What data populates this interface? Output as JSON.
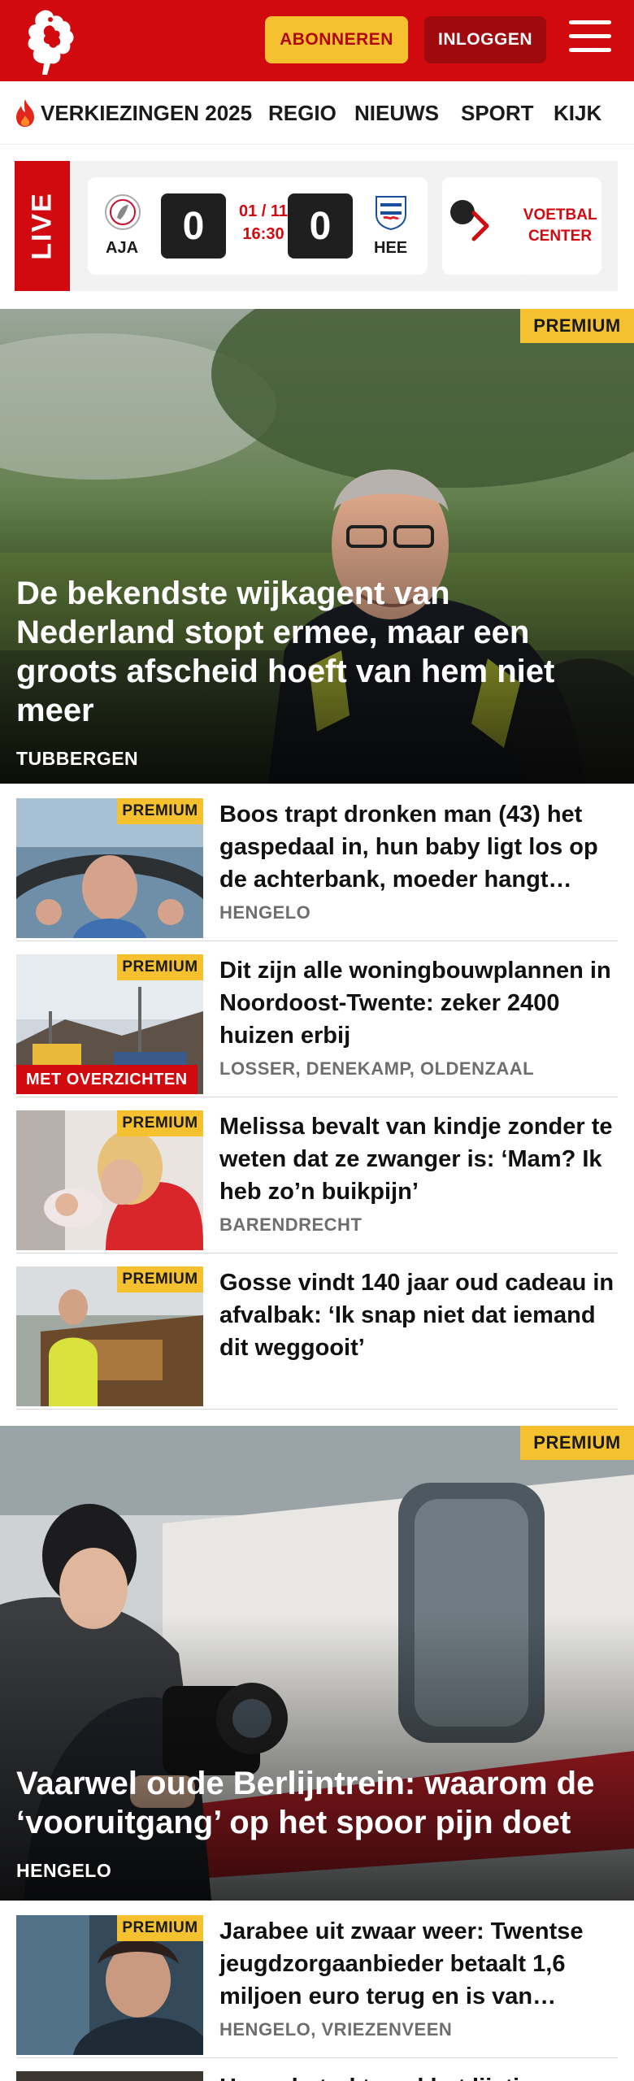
{
  "header": {
    "subscribe_label": "ABONNEREN",
    "login_label": "INLOGGEN",
    "brand_color": "#d10a10",
    "accent_color": "#f5c12e"
  },
  "nav": {
    "items": [
      {
        "label": "VERKIEZINGEN 2025",
        "icon": "flame-icon"
      },
      {
        "label": "REGIO"
      },
      {
        "label": "NIEUWS"
      },
      {
        "label": "SPORT"
      },
      {
        "label": "KIJK"
      }
    ]
  },
  "live": {
    "label": "LIVE",
    "match": {
      "home_code": "AJA",
      "home_score": "0",
      "away_code": "HEE",
      "away_score": "0",
      "date": "01 / 11",
      "time": "16:30"
    },
    "football_center_label": "VOETBAL CENTER"
  },
  "premium_label": "PREMIUM",
  "hero1": {
    "title": "De bekendste wijkagent van Nederland stopt ermee, maar een groots afscheid hoeft van hem niet meer",
    "location": "TUBBERGEN"
  },
  "articles": [
    {
      "title": "Boos trapt dronken man (43) het gaspedaal in, hun baby ligt los op de achterbank, moeder hangt…",
      "location": "HENGELO",
      "premium": true
    },
    {
      "title": "Dit zijn alle woningbouwplannen in Noordoost-Twente: zeker 2400 huizen erbij",
      "location": "LOSSER, DENEKAMP, OLDENZAAL",
      "premium": true,
      "badge": "MET OVERZICHTEN"
    },
    {
      "title": "Melissa bevalt van kindje zonder te weten dat ze zwanger is: ‘Mam? Ik heb zo’n buikpijn’",
      "location": "BARENDRECHT",
      "premium": true
    },
    {
      "title": "Gosse vindt 140 jaar oud cadeau in afvalbak: ‘Ik snap niet dat iemand dit weggooit’",
      "location": "",
      "premium": true
    }
  ],
  "hero2": {
    "title": "Vaarwel oude Berlijntrein: waarom de ‘vooruitgang’ op het spoor pijn doet",
    "location": "HENGELO"
  },
  "articles2": [
    {
      "title": "Jarabee uit zwaar weer: Twentse jeugdzorgaanbieder betaalt 1,6 miljoen euro terug en is van…",
      "location": "HENGELO, VRIEZENVEEN",
      "premium": true
    },
    {
      "title": "Hengelo trekt snel het lijstje…",
      "location": ""
    }
  ]
}
